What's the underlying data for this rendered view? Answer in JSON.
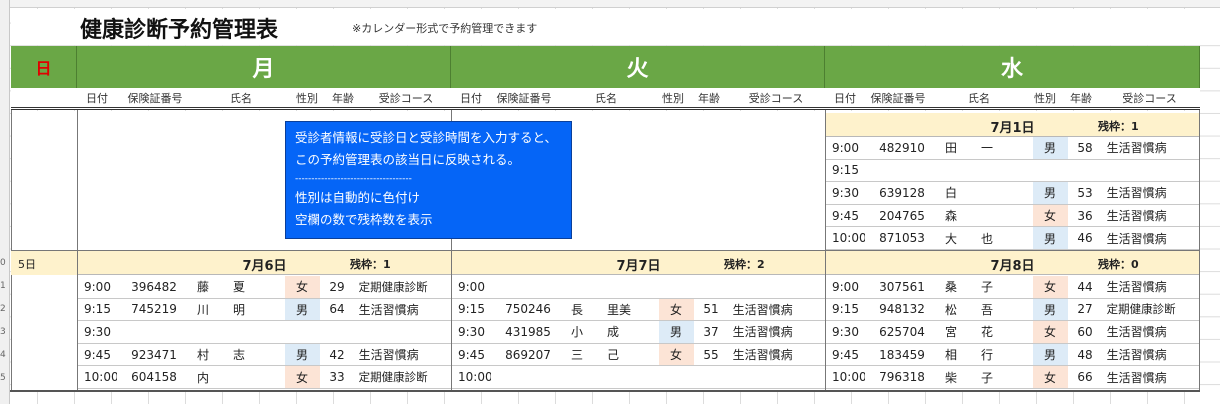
{
  "title": "健康診断予約管理表",
  "subtitle": "※カレンダー形式で予約管理できます",
  "headers": {
    "sun": "日",
    "mon": "月",
    "tue": "火",
    "wed": "水"
  },
  "col_labels": [
    "日付",
    "保険証番号",
    "氏名",
    "性別",
    "年齢",
    "受診コース"
  ],
  "row_numbers": [
    "0",
    "1",
    "2",
    "3",
    "4",
    "5"
  ],
  "sun_date": "5日",
  "note": {
    "line1": "受診者情報に受診日と受診時間を入力すると、",
    "line2": "この予約管理表の該当日に反映される。",
    "line3": "------------------------------------",
    "line4": "性別は自動的に色付け",
    "line5": "空欄の数で残枠数を表示"
  },
  "colors": {
    "header_green": "#6aa746",
    "male": "#ddebf7",
    "female": "#fce4d6",
    "day_bar": "#fef2cc",
    "note_blue": "#0565f7"
  },
  "days": {
    "jul1": {
      "date": "7月1日",
      "remaining": "残枠：1",
      "rows": [
        {
          "time": "9:00",
          "ins": "482910",
          "name": "田　　一",
          "sex": "男",
          "age": "58",
          "course": "生活習慣病"
        },
        {
          "time": "9:15",
          "ins": "",
          "name": "",
          "sex": "",
          "age": "",
          "course": ""
        },
        {
          "time": "9:30",
          "ins": "639128",
          "name": "白",
          "sex": "男",
          "age": "53",
          "course": "生活習慣病"
        },
        {
          "time": "9:45",
          "ins": "204765",
          "name": "森",
          "sex": "女",
          "age": "36",
          "course": "生活習慣病"
        },
        {
          "time": "10:00",
          "ins": "871053",
          "name": "大　　也",
          "sex": "男",
          "age": "46",
          "course": "生活習慣病"
        }
      ]
    },
    "jul6": {
      "date": "7月6日",
      "remaining": "残枠：1",
      "rows": [
        {
          "time": "9:00",
          "ins": "396482",
          "name": "藤　　夏",
          "sex": "女",
          "age": "29",
          "course": "定期健康診断"
        },
        {
          "time": "9:15",
          "ins": "745219",
          "name": "川　　明",
          "sex": "男",
          "age": "64",
          "course": "生活習慣病"
        },
        {
          "time": "9:30",
          "ins": "",
          "name": "",
          "sex": "",
          "age": "",
          "course": ""
        },
        {
          "time": "9:45",
          "ins": "923471",
          "name": "村　　志",
          "sex": "男",
          "age": "42",
          "course": "生活習慣病"
        },
        {
          "time": "10:00",
          "ins": "604158",
          "name": "内",
          "sex": "女",
          "age": "33",
          "course": "定期健康診断"
        }
      ]
    },
    "jul7": {
      "date": "7月7日",
      "remaining": "残枠：2",
      "rows": [
        {
          "time": "9:00",
          "ins": "",
          "name": "",
          "sex": "",
          "age": "",
          "course": ""
        },
        {
          "time": "9:15",
          "ins": "750246",
          "name": "長　　里美",
          "sex": "女",
          "age": "51",
          "course": "生活習慣病"
        },
        {
          "time": "9:30",
          "ins": "431985",
          "name": "小　　成",
          "sex": "男",
          "age": "37",
          "course": "生活習慣病"
        },
        {
          "time": "9:45",
          "ins": "869207",
          "name": "三　　己",
          "sex": "女",
          "age": "55",
          "course": "生活習慣病"
        },
        {
          "time": "10:00",
          "ins": "",
          "name": "",
          "sex": "",
          "age": "",
          "course": ""
        }
      ]
    },
    "jul8": {
      "date": "7月8日",
      "remaining": "残枠：0",
      "rows": [
        {
          "time": "9:00",
          "ins": "307561",
          "name": "桑　　子",
          "sex": "女",
          "age": "44",
          "course": "生活習慣病"
        },
        {
          "time": "9:15",
          "ins": "948132",
          "name": "松　　吾",
          "sex": "男",
          "age": "27",
          "course": "定期健康診断"
        },
        {
          "time": "9:30",
          "ins": "625704",
          "name": "宮　　花",
          "sex": "女",
          "age": "60",
          "course": "生活習慣病"
        },
        {
          "time": "9:45",
          "ins": "183459",
          "name": "相　　行",
          "sex": "男",
          "age": "48",
          "course": "生活習慣病"
        },
        {
          "time": "10:00",
          "ins": "796318",
          "name": "柴　　子",
          "sex": "女",
          "age": "66",
          "course": "生活習慣病"
        }
      ]
    }
  }
}
